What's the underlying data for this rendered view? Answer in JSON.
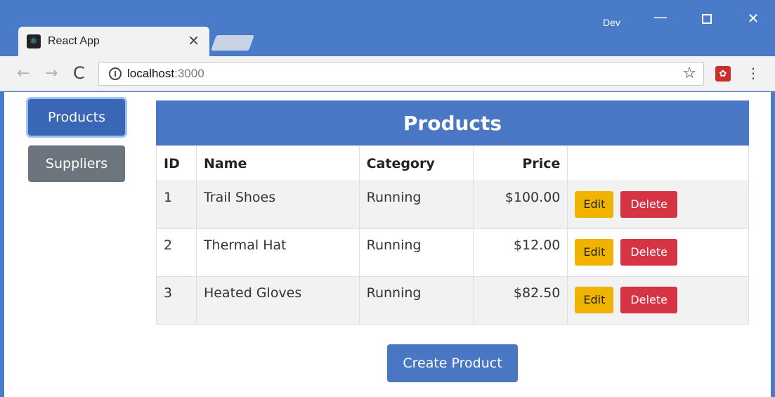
{
  "browser": {
    "tab_title": "React App",
    "tab_close": "×",
    "profile": "Dev",
    "url_host": "localhost",
    "url_port": ":3000"
  },
  "sidebar": {
    "items": [
      {
        "label": "Products",
        "active": true
      },
      {
        "label": "Suppliers",
        "active": false
      }
    ]
  },
  "table": {
    "title": "Products",
    "columns": [
      "ID",
      "Name",
      "Category",
      "Price",
      ""
    ],
    "rows": [
      {
        "id": "1",
        "name": "Trail Shoes",
        "category": "Running",
        "price": "$100.00"
      },
      {
        "id": "2",
        "name": "Thermal Hat",
        "category": "Running",
        "price": "$12.00"
      },
      {
        "id": "3",
        "name": "Heated Gloves",
        "category": "Running",
        "price": "$82.50"
      }
    ],
    "edit_label": "Edit",
    "delete_label": "Delete"
  },
  "create_button": "Create Product",
  "colors": {
    "titlebar": "#4a7bc8",
    "primary": "#4a77c4",
    "secondary": "#6c757d",
    "warning": "#f0b400",
    "danger": "#d63345"
  }
}
